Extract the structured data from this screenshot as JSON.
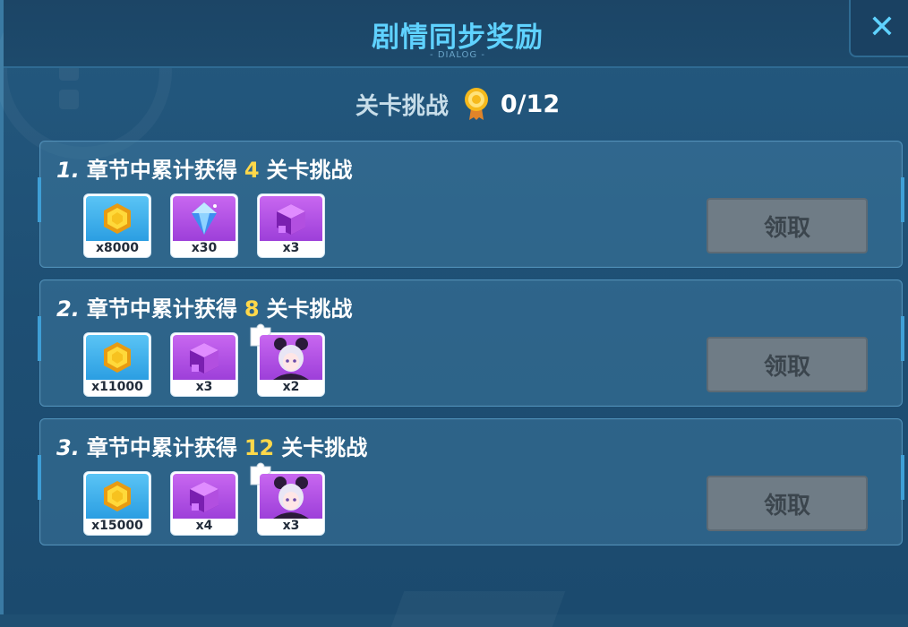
{
  "dialog": {
    "title": "剧情同步奖励",
    "subtitle": "- DIALOG -",
    "close_icon": "close-icon",
    "close_glyph": "✕"
  },
  "progress": {
    "label": "关卡挑战",
    "icon": "medal-icon",
    "value": "0/12"
  },
  "tasks": [
    {
      "number": "1.",
      "prefix": "章节中累计获得",
      "count": "4",
      "suffix": "关卡挑战",
      "button": "领取",
      "rewards": [
        {
          "icon": "gold-coin-icon",
          "qty": "x8000"
        },
        {
          "icon": "blue-crystal-icon",
          "qty": "x30"
        },
        {
          "icon": "purple-cube-icon",
          "qty": "x3"
        }
      ]
    },
    {
      "number": "2.",
      "prefix": "章节中累计获得",
      "count": "8",
      "suffix": "关卡挑战",
      "button": "领取",
      "rewards": [
        {
          "icon": "gold-coin-icon",
          "qty": "x11000"
        },
        {
          "icon": "purple-cube-icon",
          "qty": "x3"
        },
        {
          "icon": "character-fragment-icon",
          "qty": "x2"
        }
      ]
    },
    {
      "number": "3.",
      "prefix": "章节中累计获得",
      "count": "12",
      "suffix": "关卡挑战",
      "button": "领取",
      "rewards": [
        {
          "icon": "gold-coin-icon",
          "qty": "x15000"
        },
        {
          "icon": "purple-cube-icon",
          "qty": "x4"
        },
        {
          "icon": "character-fragment-icon",
          "qty": "x3"
        }
      ]
    }
  ],
  "colors": {
    "title": "#5fd2ff",
    "highlight": "#ffd84a",
    "button_disabled": "#6f7c86"
  }
}
